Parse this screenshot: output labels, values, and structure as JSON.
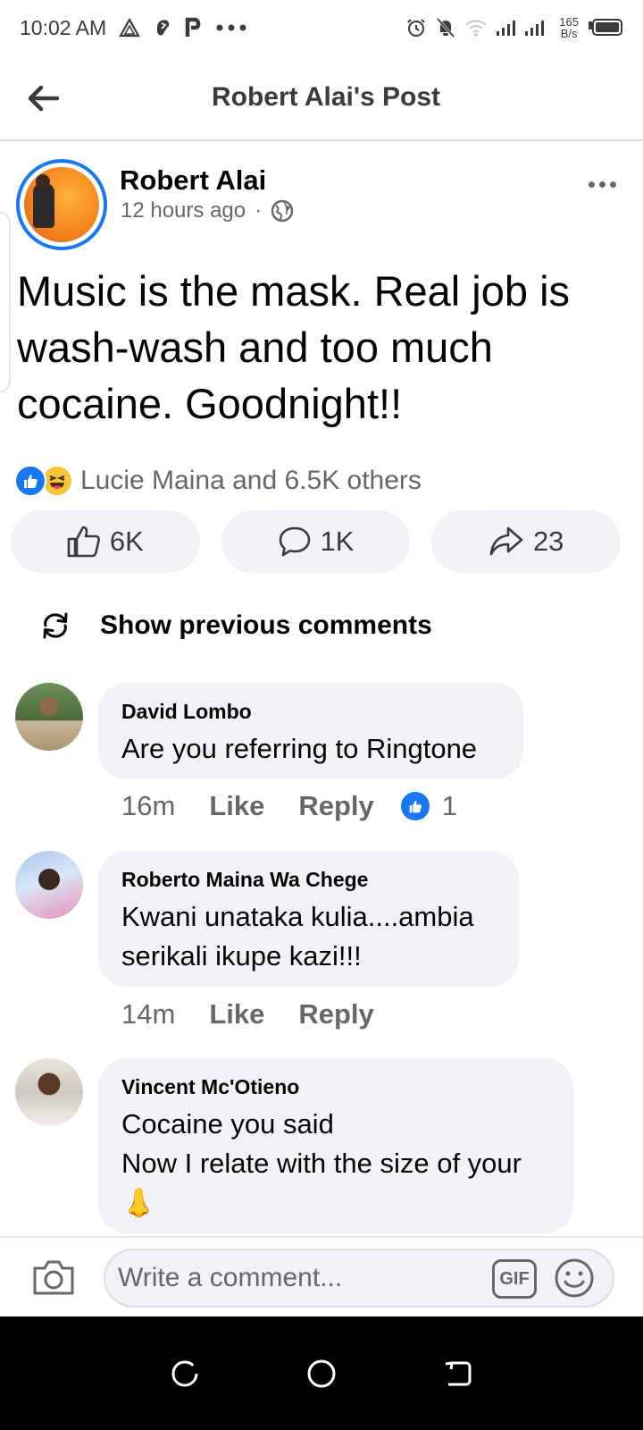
{
  "status_bar": {
    "time": "10:02 AM",
    "app_icons": [
      "warning-triangle-icon",
      "hand-icon",
      "p-icon",
      "more-dots-icon"
    ],
    "system_icons": [
      "alarm-icon",
      "mute-icon",
      "wifi-icon",
      "signal-icon",
      "battery-icon"
    ],
    "speed_value": "165",
    "speed_unit": "B/s"
  },
  "header": {
    "title": "Robert Alai's Post",
    "back_icon": "arrow-left-icon"
  },
  "post": {
    "author": "Robert Alai",
    "time": "12 hours ago",
    "separator": "·",
    "privacy_icon": "globe-icon",
    "text": "Music is the mask. Real job is wash-wash and too much cocaine. Goodnight!!",
    "reactions_text": "Lucie Maina and 6.5K others",
    "reaction_icons": [
      "like-reaction-icon",
      "haha-reaction-icon"
    ],
    "like_count": "6K",
    "comment_count": "1K",
    "share_count": "23"
  },
  "comments_section": {
    "show_previous_label": "Show previous comments",
    "comments": [
      {
        "name": "David Lombo",
        "text": "Are you referring to Ringtone",
        "time": "16m",
        "like_label": "Like",
        "reply_label": "Reply",
        "reaction_count": "1"
      },
      {
        "name": "Roberto Maina Wa Chege",
        "text_lines": [
          "Kwani unataka kulia....ambia",
          "serikali ikupe kazi!!!"
        ],
        "time": "14m",
        "like_label": "Like",
        "reply_label": "Reply"
      },
      {
        "name": "Vincent Mc'Otieno",
        "text_lines": [
          "Cocaine you said",
          "Now I relate with the size of your",
          "👃"
        ]
      }
    ]
  },
  "composer": {
    "placeholder": "Write a comment...",
    "gif_label": "GIF"
  },
  "colors": {
    "accent": "#1877f2",
    "text_primary": "#050505",
    "text_secondary": "#65676b",
    "bubble_bg": "#f0f2f5"
  }
}
